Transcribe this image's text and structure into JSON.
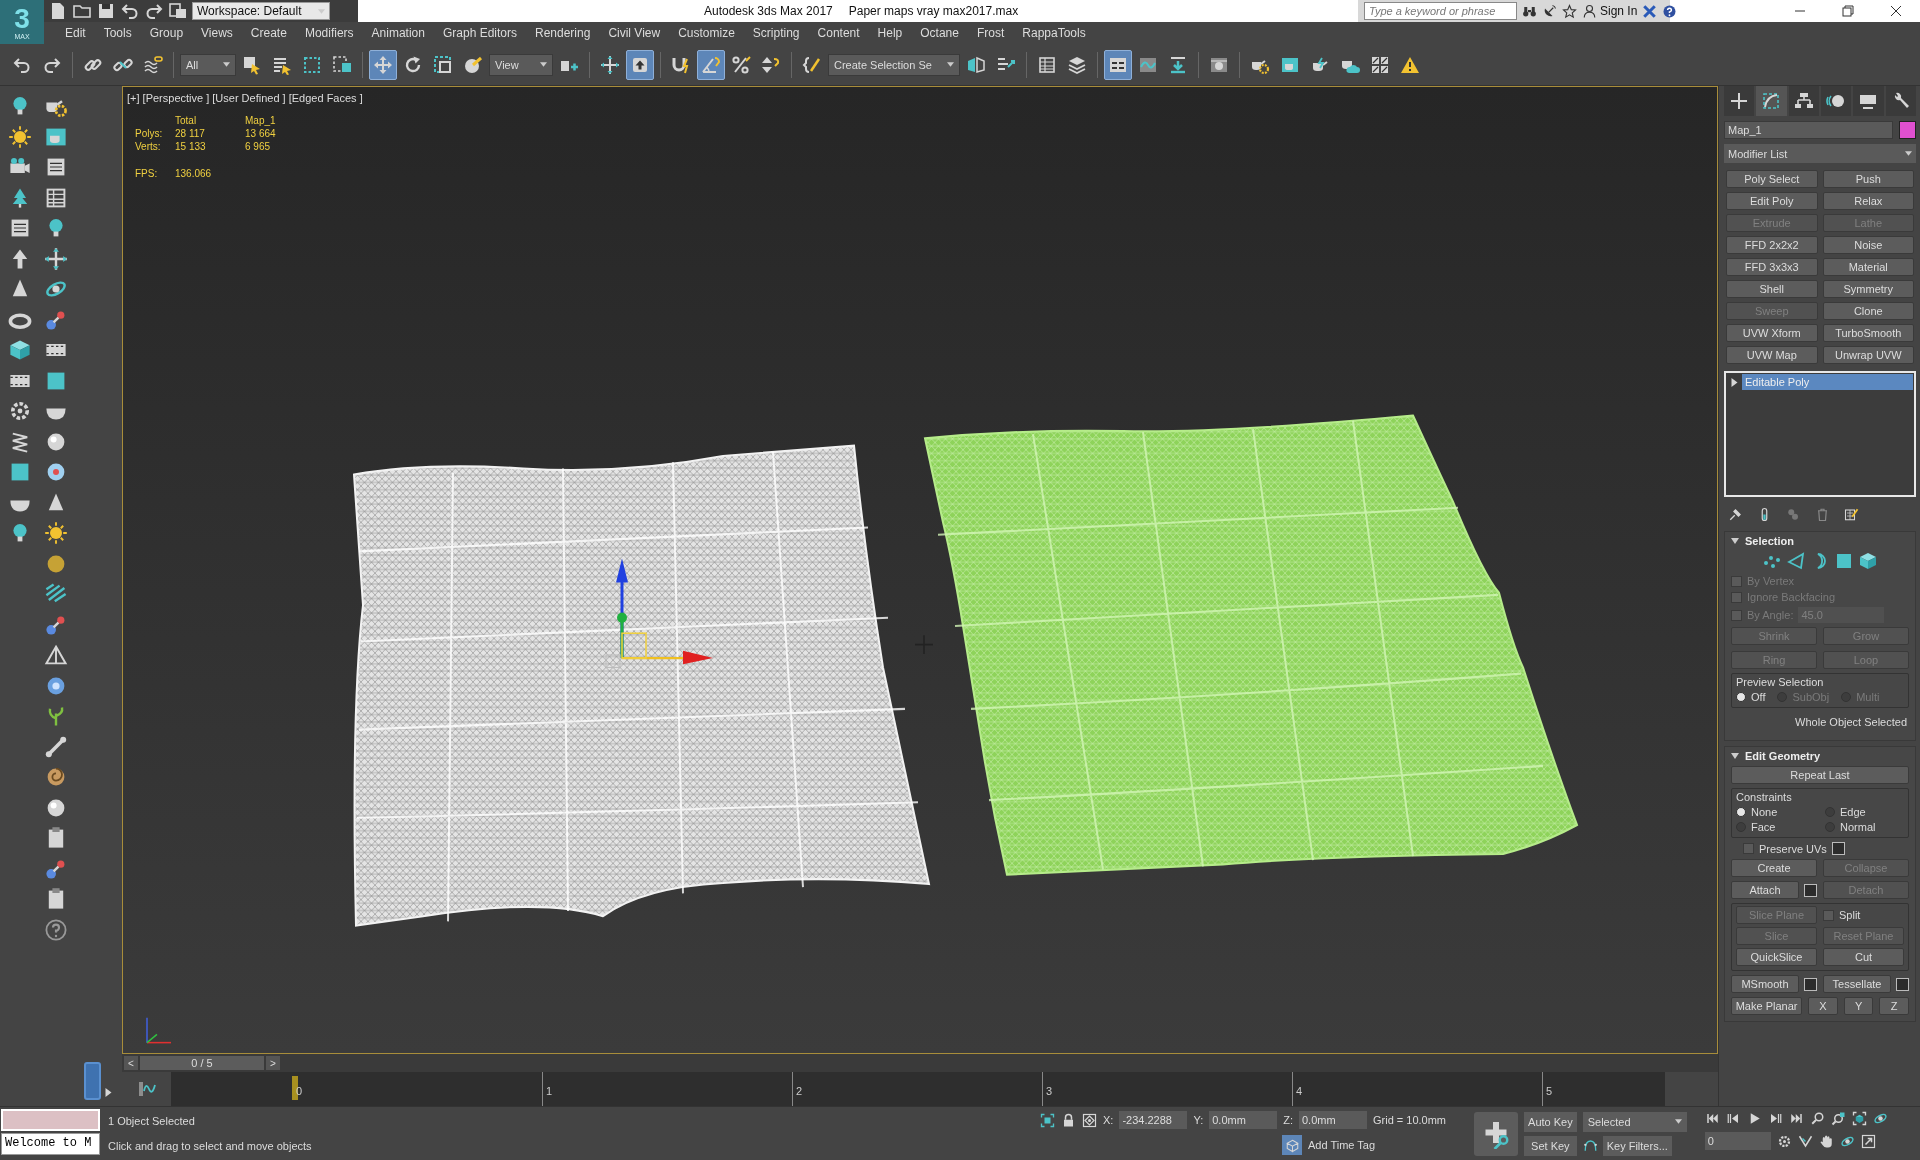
{
  "window": {
    "logo": "3",
    "logo_sub": "MAX",
    "workspace": "Workspace: Default",
    "app_title": "Autodesk 3ds Max 2017",
    "file_title": "Paper maps vray max2017.max"
  },
  "infocenter": {
    "placeholder": "Type a keyword or phrase",
    "sign_in": "Sign In"
  },
  "menu": [
    "Edit",
    "Tools",
    "Group",
    "Views",
    "Create",
    "Modifiers",
    "Animation",
    "Graph Editors",
    "Rendering",
    "Civil View",
    "Customize",
    "Scripting",
    "Content",
    "Help",
    "Octane",
    "Frost",
    "RappaTools"
  ],
  "toolbar": [
    {
      "kind": "undo",
      "selected": false
    },
    {
      "kind": "redo",
      "selected": false
    },
    {
      "kind": "sep"
    },
    {
      "kind": "link",
      "selected": false
    },
    {
      "kind": "unlink",
      "selected": false
    },
    {
      "kind": "waves",
      "selected": false
    },
    {
      "kind": "sep"
    },
    {
      "kind": "dropdown",
      "value": "All"
    },
    {
      "kind": "select",
      "selected": false
    },
    {
      "kind": "list-select",
      "selected": false
    },
    {
      "kind": "dashed-rect",
      "selected": false
    },
    {
      "kind": "crossing",
      "selected": false
    },
    {
      "kind": "sep"
    },
    {
      "kind": "move",
      "selected": true
    },
    {
      "kind": "rotate",
      "selected": false
    },
    {
      "kind": "scale",
      "selected": false
    },
    {
      "kind": "sphere-arrow",
      "selected": false
    },
    {
      "kind": "dropdown",
      "value": "View"
    },
    {
      "kind": "pivot",
      "selected": false
    },
    {
      "kind": "sep"
    },
    {
      "kind": "crosshair",
      "selected": false
    },
    {
      "kind": "arrow-key",
      "selected": true
    },
    {
      "kind": "sep"
    },
    {
      "kind": "magnet",
      "selected": false
    },
    {
      "kind": "angle",
      "selected": true
    },
    {
      "kind": "percent",
      "selected": false
    },
    {
      "kind": "spinner",
      "selected": false
    },
    {
      "kind": "sep"
    },
    {
      "kind": "braces",
      "selected": false
    },
    {
      "kind": "dropdown",
      "value": "Create Selection Se"
    },
    {
      "kind": "mirror",
      "selected": false
    },
    {
      "kind": "align",
      "selected": false
    },
    {
      "kind": "sep"
    },
    {
      "kind": "table",
      "selected": false
    },
    {
      "kind": "layers",
      "selected": false
    },
    {
      "kind": "sep"
    },
    {
      "kind": "ribbon",
      "selected": true
    },
    {
      "kind": "curve",
      "selected": false
    },
    {
      "kind": "download",
      "selected": false
    },
    {
      "kind": "sep"
    },
    {
      "kind": "material",
      "selected": false
    },
    {
      "kind": "sep"
    },
    {
      "kind": "teapot-gear",
      "selected": false
    },
    {
      "kind": "frame-window",
      "selected": false
    },
    {
      "kind": "teapot-bolt",
      "selected": false
    },
    {
      "kind": "teapot-cloud",
      "selected": false
    },
    {
      "kind": "grid",
      "selected": false
    },
    {
      "kind": "warning",
      "selected": false
    }
  ],
  "viewport": {
    "label": "[+] [Perspective ] [User Defined ] [Edged Faces ]",
    "stats": {
      "headers": [
        "Total",
        "Map_1"
      ],
      "rows": [
        {
          "label": "Polys:",
          "values": [
            "28 117",
            "13 664"
          ]
        },
        {
          "label": "Verts:",
          "values": [
            "15 133",
            "6 965"
          ]
        }
      ],
      "fps_label": "FPS:",
      "fps": "136.066"
    }
  },
  "command_panel": {
    "tabs": [
      {
        "kind": "plus",
        "selected": false
      },
      {
        "kind": "curve-box",
        "selected": true
      },
      {
        "kind": "hierarchy",
        "selected": false
      },
      {
        "kind": "disc",
        "selected": false
      },
      {
        "kind": "monitor",
        "selected": false
      },
      {
        "kind": "wrench",
        "selected": false
      }
    ],
    "object_name": "Map_1",
    "object_swatch": {
      "color": "#e050d0"
    },
    "modifier_list": "Modifier List",
    "modifier_buttons": [
      {
        "label": "Poly Select",
        "disabled": false
      },
      {
        "label": "Push",
        "disabled": false
      },
      {
        "label": "Edit Poly",
        "disabled": false
      },
      {
        "label": "Relax",
        "disabled": false
      },
      {
        "label": "Extrude",
        "disabled": true
      },
      {
        "label": "Lathe",
        "disabled": true
      },
      {
        "label": "FFD 2x2x2",
        "disabled": false
      },
      {
        "label": "Noise",
        "disabled": false
      },
      {
        "label": "FFD 3x3x3",
        "disabled": false
      },
      {
        "label": "Material",
        "disabled": false
      },
      {
        "label": "Shell",
        "disabled": false
      },
      {
        "label": "Symmetry",
        "disabled": false
      },
      {
        "label": "Sweep",
        "disabled": true
      },
      {
        "label": "Clone",
        "disabled": false
      },
      {
        "label": "UVW Xform",
        "disabled": false
      },
      {
        "label": "TurboSmooth",
        "disabled": false
      },
      {
        "label": "UVW Map",
        "disabled": false
      },
      {
        "label": "Unwrap UVW",
        "disabled": false
      }
    ],
    "stack": [
      {
        "label": "Editable Poly",
        "selected": true
      }
    ],
    "selection": {
      "title": "Selection",
      "options": [
        {
          "label": "By Vertex",
          "checked": false,
          "disabled": true
        },
        {
          "label": "Ignore Backfacing",
          "checked": false,
          "disabled": true
        },
        {
          "label": "By Angle:",
          "checked": false,
          "disabled": true
        }
      ],
      "angle": "45.0",
      "buttons": [
        {
          "label": "Shrink",
          "disabled": true
        },
        {
          "label": "Grow",
          "disabled": true
        },
        {
          "label": "Ring",
          "disabled": true
        },
        {
          "label": "Loop",
          "disabled": true
        }
      ],
      "preview": {
        "title": "Preview Selection",
        "options": [
          {
            "label": "Off",
            "selected": true,
            "disabled": false
          },
          {
            "label": "SubObj",
            "selected": false,
            "disabled": true
          },
          {
            "label": "Multi",
            "selected": false,
            "disabled": true
          }
        ]
      },
      "status": "Whole Object Selected"
    },
    "edit_geometry": {
      "title": "Edit Geometry",
      "repeat_last": "Repeat Last",
      "constraints": {
        "title": "Constraints",
        "options": [
          {
            "label": "None",
            "selected": true
          },
          {
            "label": "Edge",
            "selected": false
          },
          {
            "label": "Face",
            "selected": false
          },
          {
            "label": "Normal",
            "selected": false
          }
        ]
      },
      "preserve_uvs": {
        "label": "Preserve UVs",
        "checked": false
      },
      "rows": [
        [
          {
            "label": "Create",
            "disabled": false,
            "settings": false
          },
          {
            "label": "Collapse",
            "disabled": true,
            "settings": false
          }
        ],
        [
          {
            "label": "Attach",
            "disabled": false,
            "settings": true
          },
          {
            "label": "Detach",
            "disabled": true,
            "settings": false
          }
        ]
      ],
      "slice_rows": [
        [
          {
            "label": "Slice Plane",
            "disabled": true,
            "settings": false
          },
          {
            "kind": "checkbox",
            "label": "Split",
            "checked": false
          }
        ],
        [
          {
            "label": "Slice",
            "disabled": true,
            "settings": false
          },
          {
            "label": "Reset Plane",
            "disabled": true,
            "settings": false
          }
        ],
        [
          {
            "label": "QuickSlice",
            "disabled": false,
            "settings": false
          },
          {
            "label": "Cut",
            "disabled": false,
            "settings": false
          }
        ]
      ],
      "bottom_rows": [
        [
          {
            "label": "MSmooth",
            "disabled": false,
            "settings": true
          },
          {
            "label": "Tessellate",
            "disabled": false,
            "settings": true
          }
        ],
        [
          {
            "label": "Make Planar",
            "disabled": false,
            "settings": false
          },
          {
            "label": "X",
            "disabled": false,
            "settings": false
          },
          {
            "label": "Y",
            "disabled": false,
            "settings": false
          },
          {
            "label": "Z",
            "disabled": false,
            "settings": false
          }
        ]
      ]
    }
  },
  "time_slider": {
    "label": "0 / 5",
    "prev": "<",
    "next": ">"
  },
  "track_bar": {
    "ticks": [
      {
        "label": "0",
        "selected": true
      },
      {
        "label": "1",
        "selected": false
      },
      {
        "label": "2",
        "selected": false
      },
      {
        "label": "3",
        "selected": false
      },
      {
        "label": "4",
        "selected": false
      },
      {
        "label": "5",
        "selected": false
      }
    ]
  },
  "status": {
    "maxscript": "Welcome to M",
    "selection": "1 Object Selected",
    "prompt": "Click and drag to select and move objects",
    "coords": [
      {
        "label": "X:",
        "value": "-234.2288"
      },
      {
        "label": "Y:",
        "value": "0.0mm"
      },
      {
        "label": "Z:",
        "value": "0.0mm"
      }
    ],
    "grid": "Grid = 10.0mm",
    "time_tag": "Add Time Tag"
  },
  "animation": {
    "auto_key": "Auto Key",
    "set_key": "Set Key",
    "key_mode": "Selected",
    "key_filters": "Key Filters...",
    "frame": "0"
  }
}
